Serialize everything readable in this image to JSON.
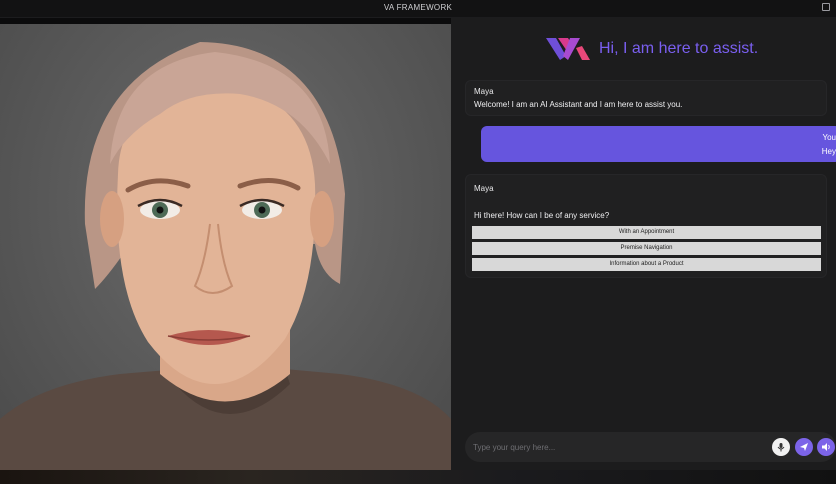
{
  "window": {
    "title": "VA FRAMEWORK"
  },
  "header": {
    "greeting": "Hi, I am here to assist."
  },
  "messages": [
    {
      "sender": "Maya",
      "text": "Welcome! I am an AI Assistant and I am here to assist you."
    },
    {
      "sender": "You",
      "text": "Hey"
    },
    {
      "sender": "Maya",
      "text": "Hi there! How can I be of any service?"
    }
  ],
  "options": [
    "With an Appointment",
    "Premise Navigation",
    "Information about a Product"
  ],
  "input": {
    "placeholder": "Type your query here..."
  },
  "colors": {
    "accent": "#6655de",
    "brand_pink": "#d93a8c",
    "panel": "#1c1c1d",
    "option_bg": "#d8d8d8"
  },
  "icons": [
    "window-maximize-icon",
    "brand-logo",
    "microphone-icon",
    "send-icon",
    "speaker-icon"
  ]
}
